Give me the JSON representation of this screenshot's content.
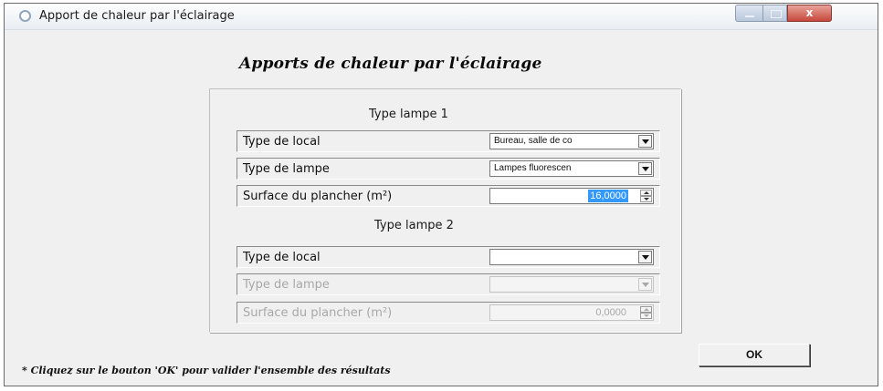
{
  "window": {
    "title": "Apport de chaleur par l'éclairage",
    "controls": [
      "minimize-icon",
      "maximize-icon",
      "close-icon"
    ],
    "close_glyph": "x"
  },
  "heading": "Apports de chaleur par l'éclairage",
  "group1": {
    "title": "Type lampe 1",
    "local_label": "Type de local",
    "local_value": "Bureau, salle de co",
    "lampe_label": "Type de lampe",
    "lampe_value": "Lampes fluorescen",
    "surface_label": "Surface du plancher (m²)",
    "surface_value": "16,0000"
  },
  "group2": {
    "title": "Type lampe 2",
    "local_label": "Type de local",
    "local_value": "",
    "lampe_label": "Type de lampe",
    "lampe_value": "",
    "surface_label": "Surface du plancher (m²)",
    "surface_value": "0,0000"
  },
  "ok_label": "OK",
  "footnote": "* Cliquez sur le bouton 'OK' pour valider l'ensemble des résultats",
  "colors": {
    "selection": "#3399ff",
    "window_bg": "#f0f0f0",
    "close_button": "#c6483a"
  }
}
